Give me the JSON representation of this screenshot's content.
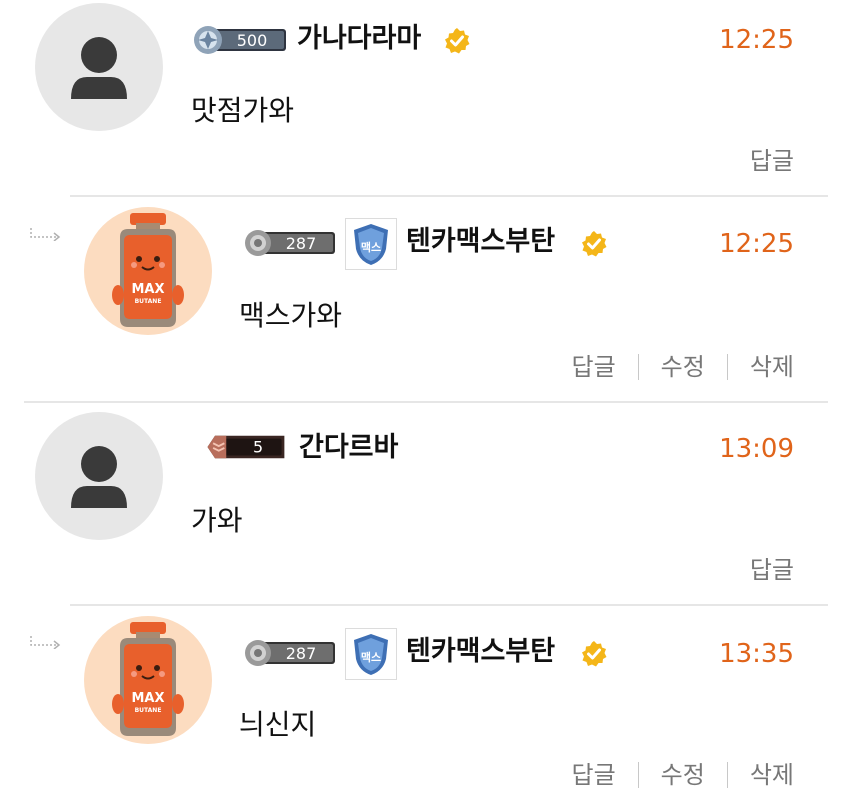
{
  "comments": [
    {
      "level": "500",
      "nickname": "가나다라마",
      "time": "12:25",
      "text": "맛점가와",
      "actions": [
        "답글"
      ]
    },
    {
      "level": "287",
      "clan_badge_text": "맥스",
      "nickname": "텐카맥스부탄",
      "time": "12:25",
      "text": "맥스가와",
      "actions": [
        "답글",
        "수정",
        "삭제"
      ]
    },
    {
      "level": "5",
      "nickname": "간다르바",
      "time": "13:09",
      "text": "가와",
      "actions": [
        "답글"
      ]
    },
    {
      "level": "287",
      "clan_badge_text": "맥스",
      "nickname": "텐카맥스부탄",
      "time": "13:35",
      "text": "늬신지",
      "actions": [
        "답글",
        "수정",
        "삭제"
      ]
    }
  ],
  "avatar_bottle_label": [
    "MAX",
    "BUTANE"
  ],
  "colors": {
    "time": "#e0641a",
    "verified": "#f4b619",
    "divider": "#e6e6e6",
    "bottle": "#e8602c"
  },
  "icons": {
    "reply": "reply-arrow-icon",
    "verified": "verified-check-icon",
    "avatar_default": "person-icon"
  }
}
